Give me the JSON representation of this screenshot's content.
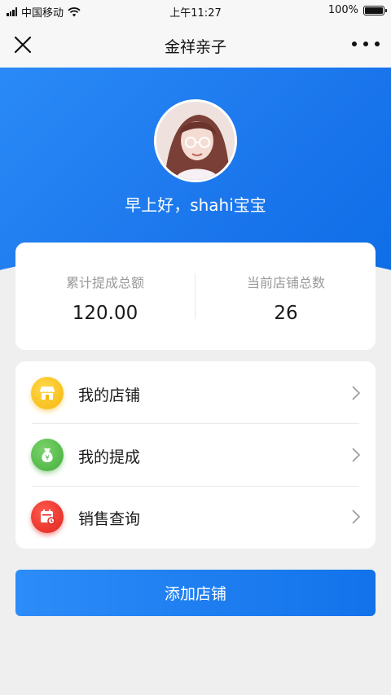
{
  "status_bar": {
    "carrier": "中国移动",
    "time": "上午11:27",
    "battery_text": "100%",
    "battery_level": 1.0
  },
  "nav": {
    "title": "金祥亲子",
    "close_icon": "close-icon",
    "more_icon": "more-icon"
  },
  "hero": {
    "greeting": "早上好，shahi宝宝",
    "gradient_start": "#2a8af6",
    "gradient_end": "#0e6de6"
  },
  "stats": [
    {
      "label": "累计提成总额",
      "value": "120.00"
    },
    {
      "label": "当前店铺总数",
      "value": "26"
    }
  ],
  "menu": {
    "items": [
      {
        "label": "我的店铺",
        "icon": "store-icon",
        "color": "#f6b70e"
      },
      {
        "label": "我的提成",
        "icon": "money-bag-icon",
        "color": "#45ae3b"
      },
      {
        "label": "销售查询",
        "icon": "sales-calendar-icon",
        "color": "#e0241d"
      }
    ]
  },
  "primary_button": {
    "label": "添加店铺",
    "color": "#1b76ec"
  }
}
